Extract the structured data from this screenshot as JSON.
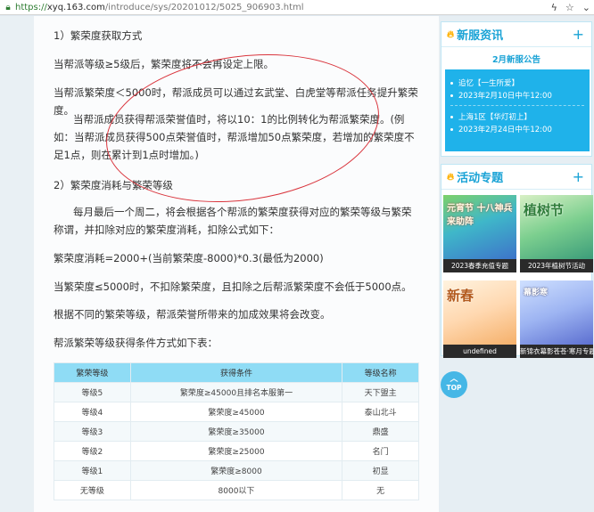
{
  "browser": {
    "url_scheme": "https://",
    "url_host": "xyq.163.com",
    "url_path": "/introduce/sys/20201012/5025_906903.html"
  },
  "article": {
    "p1": "1）繁荣度获取方式",
    "p2": "当帮派等级≥5级后，繁荣度将不会再设定上限。",
    "p3": "当帮派繁荣度＜5000时，帮派成员可以通过玄武堂、白虎堂等帮派任务提升繁荣度。",
    "p4": "当帮派成员获得帮派荣誉值时，将以10：1的比例转化为帮派繁荣度。(例如：当帮派成员获得500点荣誉值时，帮派增加50点繁荣度，若增加的繁荣度不足1点，则在累计到1点时增加。)",
    "p5": "2）繁荣度消耗与繁荣等级",
    "p6": "每月最后一个周二，将会根据各个帮派的繁荣度获得对应的繁荣等级与繁荣称谓，并扣除对应的繁荣度消耗，扣除公式如下：",
    "p7": "繁荣度消耗=2000+(当前繁荣度-8000)*0.3(最低为2000)",
    "p8": "当繁荣度≤5000时，不扣除繁荣度，且扣除之后帮派繁荣度不会低于5000点。",
    "p9": "根据不同的繁荣等级，帮派荣誉所带来的加成效果将会改变。",
    "p10": "帮派繁荣等级获得条件方式如下表："
  },
  "table": {
    "headers": [
      "繁荣等级",
      "获得条件",
      "等级名称"
    ],
    "rows": [
      [
        "等级5",
        "繁荣度≥45000且排名本服第一",
        "天下盟主"
      ],
      [
        "等级4",
        "繁荣度≥45000",
        "泰山北斗"
      ],
      [
        "等级3",
        "繁荣度≥35000",
        "鼎盛"
      ],
      [
        "等级2",
        "繁荣度≥25000",
        "名门"
      ],
      [
        "等级1",
        "繁荣度≥8000",
        "初显"
      ],
      [
        "无等级",
        "8000以下",
        "无"
      ]
    ]
  },
  "sidebar": {
    "news_title": "新服资讯",
    "news_subtitle": "2月新服公告",
    "news_items": [
      {
        "name": "追忆【一生所爱】",
        "date": "2023年2月10日中午12:00"
      },
      {
        "name": "上海1区【华灯初上】",
        "date": "2023年2月24日中午12:00"
      }
    ],
    "activity_title": "活动专题",
    "thumbs": [
      {
        "art": "元宵节 十八神兵来助阵",
        "caption": "2023春季充值专题"
      },
      {
        "art": "植树节",
        "caption": "2023年植树节活动"
      },
      {
        "art": "新春",
        "caption": "undefined"
      },
      {
        "art": "幕影寒",
        "caption": "新锦衣幕影苍苍·寒月专题"
      }
    ],
    "top_label": "TOP"
  },
  "colors": {
    "accent": "#1aa3d6",
    "news_bg": "#1fb2ea",
    "table_head": "#8fdcf5",
    "annotation": "#d9343c"
  }
}
